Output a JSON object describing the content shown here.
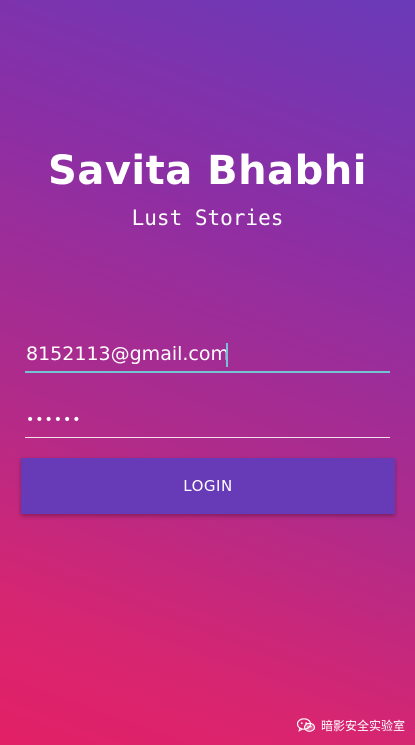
{
  "app": {
    "title": "Savita Bhabhi",
    "subtitle": "Lust Stories"
  },
  "form": {
    "email_value": "8152113@gmail.com",
    "password_value": "••••••",
    "login_label": "LOGIN"
  },
  "watermark": {
    "text": "暗影安全实验室",
    "icon": "wechat-icon"
  },
  "colors": {
    "gradient_top": "#6a3ab8",
    "gradient_bottom": "#e22066",
    "button": "#673ab7",
    "focus_underline": "#74c3d2"
  }
}
